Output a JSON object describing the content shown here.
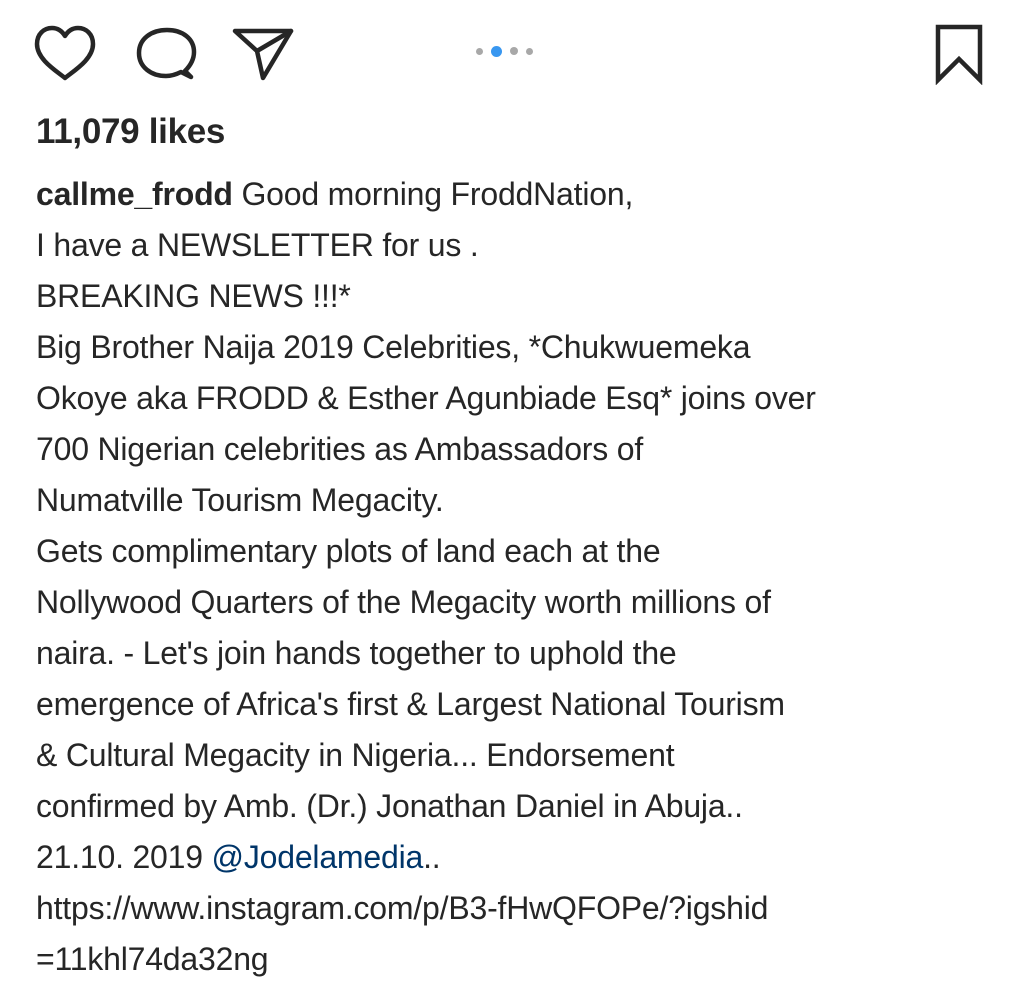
{
  "actions": {
    "like_icon": "heart-outline-icon",
    "comment_icon": "speech-bubble-icon",
    "share_icon": "paper-plane-icon",
    "save_icon": "bookmark-outline-icon"
  },
  "carousel": {
    "total": 4,
    "active_index": 1,
    "active_color": "#3897f0",
    "inactive_color": "#a8a8a8"
  },
  "likes_text": "11,079 likes",
  "caption": {
    "username": "callme_frodd",
    "line1_rest": " Good morning FroddNation,",
    "lines": [
      "I have a NEWSLETTER for us .",
      "BREAKING NEWS !!!*",
      "Big Brother Naija 2019 Celebrities, *Chukwuemeka",
      "Okoye aka FRODD & Esther Agunbiade Esq* joins over",
      "700 Nigerian celebrities as Ambassadors of",
      "Numatville Tourism Megacity.",
      "Gets complimentary plots of land each at the",
      "Nollywood Quarters of the Megacity worth millions of",
      "naira. - Let's join hands together to uphold the",
      "emergence of Africa's first & Largest National Tourism",
      "& Cultural Megacity in Nigeria... Endorsement",
      "confirmed by Amb. (Dr.) Jonathan Daniel in Abuja.."
    ],
    "date_text": "21.10. 2019 ",
    "mention": "@Jodelamedia",
    "mention_suffix": "..",
    "link_line1": "https://www.instagram.com/p/B3-fHwQFOPe/?igshid",
    "link_line2": "=11khl74da32ng"
  },
  "colors": {
    "text": "#262626",
    "mention": "#003569",
    "background": "#ffffff"
  }
}
